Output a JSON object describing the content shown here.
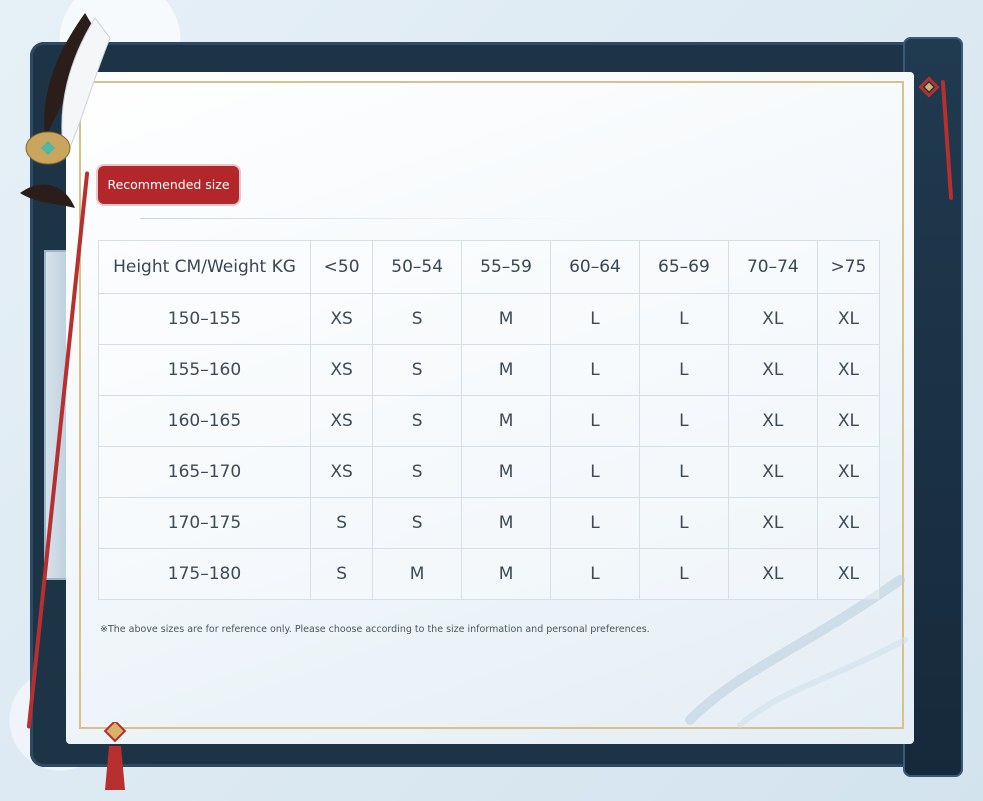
{
  "badge": "Recommended size",
  "table": {
    "header": [
      "Height CM/Weight KG",
      "<50",
      "50–54",
      "55–59",
      "60–64",
      "65–69",
      "70–74",
      ">75"
    ],
    "rows": [
      [
        "150–155",
        "XS",
        "S",
        "M",
        "L",
        "L",
        "XL",
        "XL"
      ],
      [
        "155–160",
        "XS",
        "S",
        "M",
        "L",
        "L",
        "XL",
        "XL"
      ],
      [
        "160–165",
        "XS",
        "S",
        "M",
        "L",
        "L",
        "XL",
        "XL"
      ],
      [
        "165–170",
        "XS",
        "S",
        "M",
        "L",
        "L",
        "XL",
        "XL"
      ],
      [
        "170–175",
        "S",
        "S",
        "M",
        "L",
        "L",
        "XL",
        "XL"
      ],
      [
        "175–180",
        "S",
        "M",
        "M",
        "L",
        "L",
        "XL",
        "XL"
      ]
    ]
  },
  "note": "※The above sizes are for reference only. Please choose according to the size information and personal preferences.",
  "colors": {
    "frame": "#1d3346",
    "badge": "#b3272a",
    "cord": "#b72f2f",
    "gold": "#d8c28c"
  }
}
